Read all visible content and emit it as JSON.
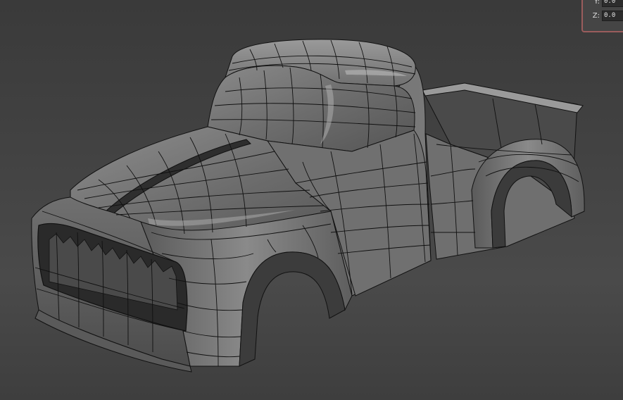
{
  "viewport": {
    "background_top": "#3a3a3a",
    "background_bottom": "#444444",
    "model_name": "",
    "render_mode": "shaded-with-edged-faces"
  },
  "model": {
    "body_shade_light": "#8c8c8c",
    "body_shade_mid": "#6a6a6a",
    "body_shade_dark": "#474747",
    "wire_color": "#111111"
  },
  "coordinate_panel": {
    "border_color": "#9a5c5c",
    "rows": [
      {
        "axis": "Y:",
        "value": "0.0"
      },
      {
        "axis": "Z:",
        "value": "0.0"
      }
    ]
  }
}
